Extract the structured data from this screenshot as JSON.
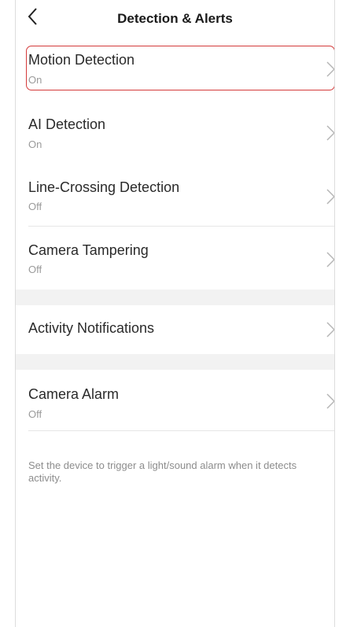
{
  "header": {
    "title": "Detection & Alerts",
    "back_icon": "chevron-left-icon"
  },
  "settings": {
    "motion_detection": {
      "label": "Motion Detection",
      "value": "On"
    },
    "ai_detection": {
      "label": "AI Detection",
      "value": "On"
    },
    "line_crossing": {
      "label": "Line-Crossing Detection",
      "value": "Off"
    },
    "camera_tampering": {
      "label": "Camera Tampering",
      "value": "Off"
    },
    "activity_notifications": {
      "label": "Activity Notifications"
    },
    "camera_alarm": {
      "label": "Camera Alarm",
      "value": "Off"
    }
  },
  "footnote": "Set the device to trigger a light/sound alarm when it detects activity.",
  "colors": {
    "highlight": "#d43a3a",
    "section_gap": "#f2f2f2",
    "secondary_text": "#9a9a9a"
  }
}
